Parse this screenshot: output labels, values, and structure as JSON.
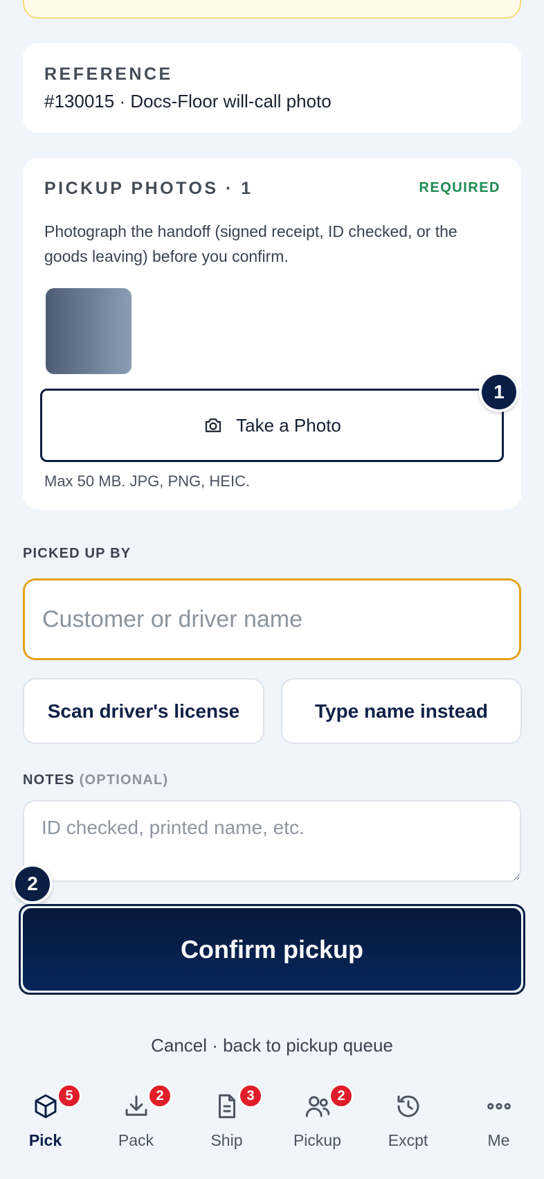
{
  "reference": {
    "title": "REFERENCE",
    "value": "#130015 · Docs-Floor will-call photo"
  },
  "photos": {
    "title": "PICKUP PHOTOS · 1",
    "required": "REQUIRED",
    "description": "Photograph the handoff (signed receipt, ID checked, or the goods leaving) before you confirm.",
    "take_photo_label": "Take a Photo",
    "max_size": "Max 50 MB. JPG, PNG, HEIC."
  },
  "picked_up_by": {
    "label": "PICKED UP BY",
    "placeholder": "Customer or driver name",
    "scan_button": "Scan driver's license",
    "type_button": "Type name instead"
  },
  "notes": {
    "label": "NOTES",
    "optional": "(OPTIONAL)",
    "placeholder": "ID checked, printed name, etc."
  },
  "step_badges": {
    "first": "1",
    "second": "2"
  },
  "confirm_label": "Confirm pickup",
  "cancel_label": "Cancel · back to pickup queue",
  "tabs": [
    {
      "label": "Pick",
      "badge": "5",
      "icon": "cube-icon",
      "active": true
    },
    {
      "label": "Pack",
      "badge": "2",
      "icon": "download-icon",
      "active": false
    },
    {
      "label": "Ship",
      "badge": "3",
      "icon": "document-icon",
      "active": false
    },
    {
      "label": "Pickup",
      "badge": "2",
      "icon": "users-icon",
      "active": false
    },
    {
      "label": "Excpt",
      "badge": "",
      "icon": "history-icon",
      "active": false
    },
    {
      "label": "Me",
      "badge": "",
      "icon": "more-icon",
      "active": false
    }
  ],
  "colors": {
    "accent_navy": "#0b1f45",
    "required_green": "#1b8a50",
    "input_focus_orange": "#e5a11e",
    "badge_red": "#e11d2a"
  }
}
